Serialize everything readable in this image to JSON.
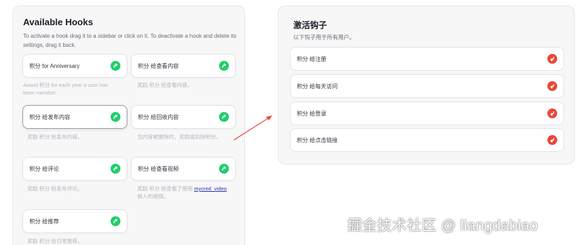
{
  "available": {
    "title": "Available Hooks",
    "description": "To activate a hook drag it to a sidebar or click on it. To deactivate a hook and delete its settings, drag it back.",
    "hooks": [
      {
        "label": "积分 for Anniversary",
        "desc_lines": [
          "Award 积分 for each year a user has",
          "been member."
        ]
      },
      {
        "label": "积分 给查看内容",
        "desc_lines": [
          "奖励 积分 给查看内容。"
        ]
      },
      {
        "label": "积分 给发布内容",
        "desc_lines": [
          "奖励 积分 给发布内容。"
        ]
      },
      {
        "label": "积分 给回收内容",
        "desc_lines": [
          "当内容被删除时，奖励或扣除积分。"
        ]
      },
      {
        "label": "积分 给评论",
        "desc_lines": [
          "奖励 积分 给发布评论。"
        ]
      },
      {
        "label": "积分 给查看视频",
        "desc_before": "奖励 积分 给查看了使用 ",
        "desc_link": "mycred_video",
        "desc_after": "嵌入的视频。"
      },
      {
        "label": "积分 给推荐",
        "desc_lines": [
          "奖励 积分 给日常推荐。"
        ]
      }
    ]
  },
  "active": {
    "title": "激活钩子",
    "description": "以下钩子用于所有用户。",
    "hooks": [
      {
        "label": "积分 给注册"
      },
      {
        "label": "积分 给每天访问"
      },
      {
        "label": "积分 给登录"
      },
      {
        "label": "积分 给点击链接"
      }
    ]
  },
  "icons": {
    "add": "add-arrow-icon",
    "remove": "remove-arrow-icon",
    "drag_arrow": "drag-direction-arrow"
  },
  "colors": {
    "add_button": "#1fcf6a",
    "remove_button": "#e8473a",
    "drag_arrow": "#e8473a",
    "link": "#2c3aa8"
  },
  "watermark": "掘金技术社区 @ liangdabiao"
}
